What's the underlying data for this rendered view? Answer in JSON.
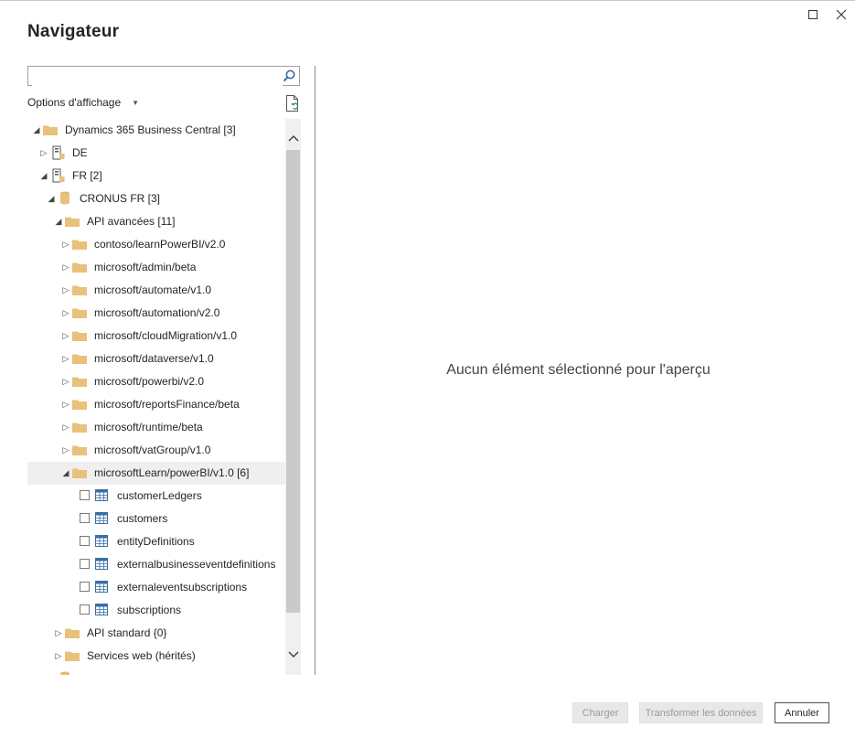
{
  "window": {
    "title": "Navigateur"
  },
  "search": {
    "value": "",
    "placeholder": ""
  },
  "display_options": {
    "label": "Options d'affichage"
  },
  "tree": {
    "root": {
      "label": "Dynamics 365 Business Central [3]",
      "expanded": true
    },
    "env_de": {
      "label": "DE",
      "expanded": false
    },
    "env_fr": {
      "label": "FR [2]",
      "expanded": true
    },
    "company": {
      "label": "CRONUS FR [3]",
      "expanded": true
    },
    "api_advanced": {
      "label": "API avancées [11]",
      "expanded": true
    },
    "api_folders": [
      {
        "label": "contoso/learnPowerBI/v2.0"
      },
      {
        "label": "microsoft/admin/beta"
      },
      {
        "label": "microsoft/automate/v1.0"
      },
      {
        "label": "microsoft/automation/v2.0"
      },
      {
        "label": "microsoft/cloudMigration/v1.0"
      },
      {
        "label": "microsoft/dataverse/v1.0"
      },
      {
        "label": "microsoft/powerbi/v2.0"
      },
      {
        "label": "microsoft/reportsFinance/beta"
      },
      {
        "label": "microsoft/runtime/beta"
      },
      {
        "label": "microsoft/vatGroup/v1.0"
      }
    ],
    "selected_folder": {
      "label": "microsoftLearn/powerBI/v1.0 [6]",
      "expanded": true
    },
    "tables": [
      {
        "label": "customerLedgers",
        "checked": false
      },
      {
        "label": "customers",
        "checked": false
      },
      {
        "label": "entityDefinitions",
        "checked": false
      },
      {
        "label": "externalbusinesseventdefinitions",
        "checked": false
      },
      {
        "label": "externaleventsubscriptions",
        "checked": false
      },
      {
        "label": "subscriptions",
        "checked": false
      }
    ],
    "api_standard": {
      "label": "API standard {0}"
    },
    "web_services": {
      "label": "Services web (hérités)"
    }
  },
  "preview": {
    "empty_message": "Aucun élément sélectionné pour l'aperçu"
  },
  "footer": {
    "load_label": "Charger",
    "transform_label": "Transformer les données",
    "cancel_label": "Annuler"
  },
  "colors": {
    "folder": "#e8c17a",
    "table_icon": "#3a6ea5",
    "selected_row": "#efefef",
    "scroll_thumb": "#c9c9c9"
  }
}
